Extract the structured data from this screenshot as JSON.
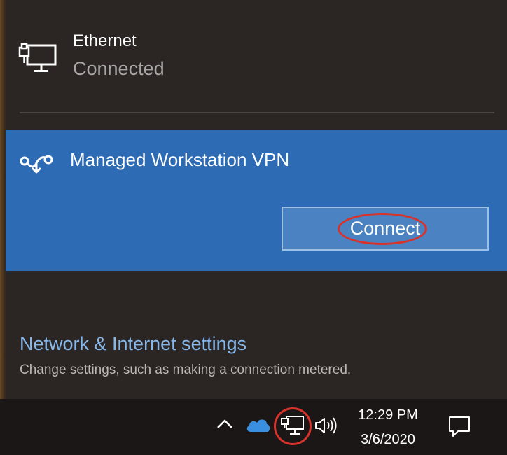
{
  "ethernet": {
    "icon": "ethernet-monitor-icon",
    "name": "Ethernet",
    "status": "Connected"
  },
  "vpn": {
    "icon": "vpn-icon",
    "name": "Managed Workstation VPN",
    "connect_label": "Connect",
    "background_color": "#2d6bb5",
    "highlight_color": "#d9322a"
  },
  "settings": {
    "link_label": "Network & Internet settings",
    "description": "Change settings, such as making a connection metered.",
    "link_color": "#86b7ea"
  },
  "taskbar": {
    "tray_icons": [
      "chevron-up-icon",
      "onedrive-cloud-icon",
      "network-icon",
      "volume-icon"
    ],
    "time": "12:29 PM",
    "date": "3/6/2020",
    "action_center_icon": "action-center-icon"
  }
}
